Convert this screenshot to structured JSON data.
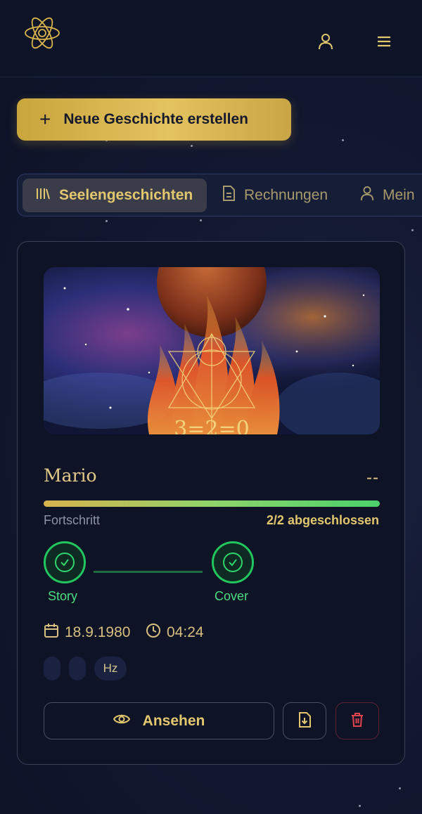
{
  "header": {
    "logo_icon": "atom-logo-icon",
    "profile_icon": "user-icon",
    "menu_icon": "hamburger-menu-icon"
  },
  "actions": {
    "new_story_label": "Neue Geschichte erstellen",
    "new_story_icon": "plus-icon"
  },
  "tabs": [
    {
      "label": "Seelengeschichten",
      "icon": "library-icon",
      "active": true
    },
    {
      "label": "Rechnungen",
      "icon": "document-icon",
      "active": false
    },
    {
      "label": "Mein",
      "icon": "user-icon",
      "active": false
    }
  ],
  "story_card": {
    "cover_image": "cosmic-flame-planet-image",
    "cover_text": "3=2=0",
    "name": "Mario",
    "status": "--",
    "progress": {
      "label": "Fortschritt",
      "summary": "2/2 abgeschlossen",
      "fraction": 1.0
    },
    "steps": [
      {
        "label": "Story",
        "done": true
      },
      {
        "label": "Cover",
        "done": true
      }
    ],
    "date": "18.9.1980",
    "time": "04:24",
    "chips": [
      "",
      "",
      "Hz"
    ],
    "view_label": "Ansehen",
    "download_icon": "file-download-icon",
    "delete_icon": "trash-icon"
  },
  "colors": {
    "gold": "#e3c76e",
    "green": "#22c55e",
    "danger": "#e0454f",
    "background": "#121830"
  }
}
